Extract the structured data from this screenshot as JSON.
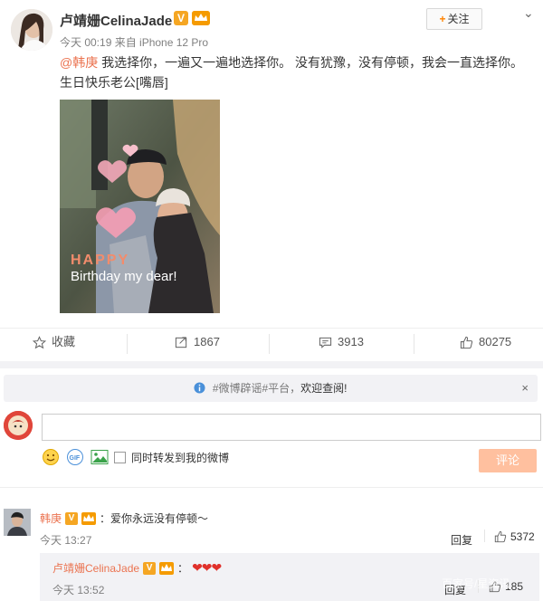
{
  "post": {
    "author": "卢靖姗CelinaJade",
    "v_badge": "V",
    "vip_badge": "",
    "meta": "今天 00:19 来自 iPhone 12 Pro",
    "follow_label": "关注",
    "mention": "@韩庚",
    "text": " 我选择你，一遍又一遍地选择你。 没有犹豫，没有停顿，我会一直选择你。 生日快乐老公[嘴唇]",
    "photo_caption": "Birthday my dear!",
    "photo_sticker": "HAPPY"
  },
  "actions": {
    "favorite_label": "收藏",
    "repost_count": "1867",
    "comment_count": "3913",
    "like_count": "80275"
  },
  "notice": {
    "prefix": "#微博辟谣#平台，",
    "strong": "欢迎查阅!",
    "close": "×"
  },
  "composer": {
    "input_value": "",
    "also_repost_label": "同时转发到我的微博",
    "submit_label": "评论"
  },
  "comments": [
    {
      "user": "韩庚",
      "v_badge": "V",
      "text": "：爱你永远没有停顿～",
      "time": "今天 13:27",
      "reply_label": "回复",
      "like_count": "5372"
    },
    {
      "user": "卢靖姗CelinaJade",
      "v_badge": "V",
      "text": "：",
      "hearts": "❤❤❤",
      "time": "今天 13:52",
      "reply_label": "回复",
      "like_count": "185"
    }
  ],
  "watermark": "百家号/星资讯",
  "colors": {
    "accent": "#ff8200",
    "link": "#eb7350",
    "submit_disabled": "#ffc09f"
  }
}
